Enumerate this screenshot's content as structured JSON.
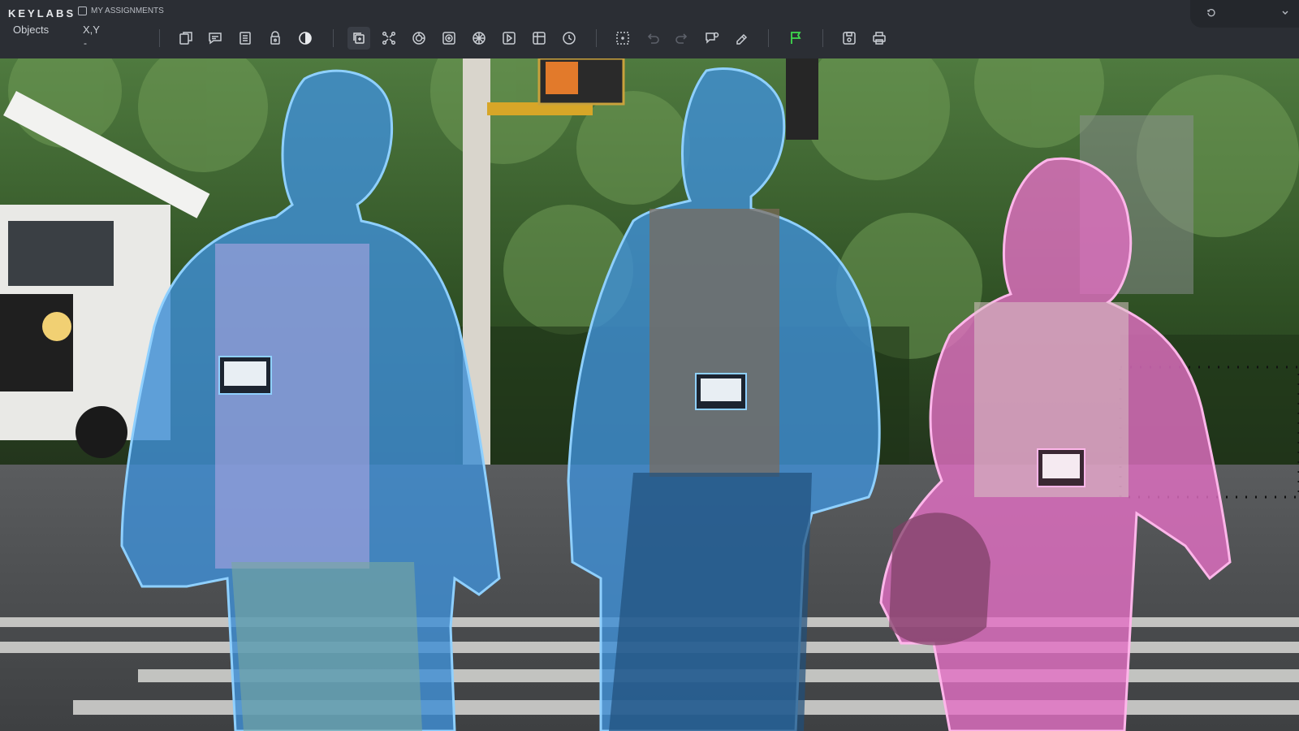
{
  "header": {
    "brand": "KEYLABS",
    "assignments_label": "MY ASSIGNMENTS"
  },
  "panel": {
    "objects_label": "Objects",
    "coord_label": "X,Y",
    "coord_value": "-"
  },
  "toolbar": {
    "tools": [
      {
        "icon": "add-frame-icon"
      },
      {
        "icon": "comment-icon"
      },
      {
        "icon": "list-icon"
      },
      {
        "icon": "lock-icon"
      },
      {
        "icon": "contrast-icon"
      },
      {
        "icon": "copy-frame-icon",
        "active": true
      },
      {
        "icon": "keypoints-icon"
      },
      {
        "icon": "target-icon"
      },
      {
        "icon": "mask-icon"
      },
      {
        "icon": "grid-icon"
      },
      {
        "icon": "sam-icon"
      },
      {
        "icon": "table-icon"
      },
      {
        "icon": "timer-icon"
      },
      {
        "icon": "select-icon"
      },
      {
        "icon": "undo-icon"
      },
      {
        "icon": "redo-icon"
      },
      {
        "icon": "feedback-icon"
      },
      {
        "icon": "eraser-icon"
      },
      {
        "icon": "flag-icon"
      },
      {
        "icon": "save-icon"
      },
      {
        "icon": "print-icon"
      }
    ]
  },
  "annotations": {
    "colors": {
      "person_blue": "#3f8fd4",
      "person_pink": "#e46fc4",
      "outline_blue": "#8fd0ff",
      "outline_pink": "#ffb6ea"
    }
  }
}
